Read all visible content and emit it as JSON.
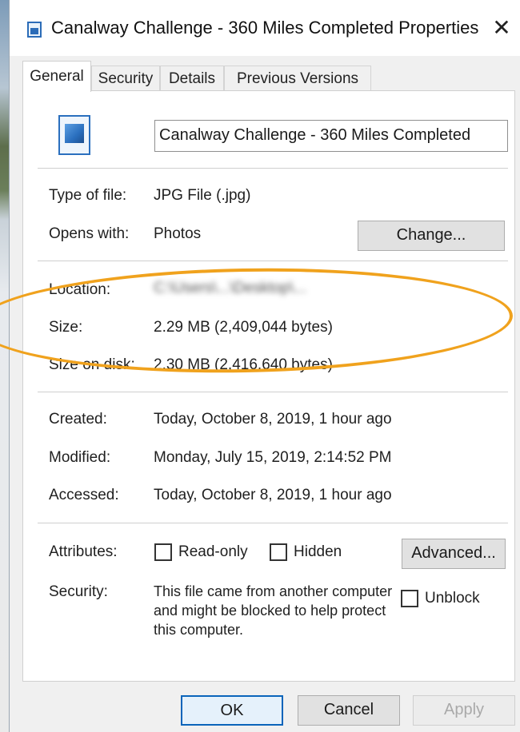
{
  "window": {
    "title": "Canalway Challenge - 360 Miles Completed Properties",
    "close_glyph": "✕"
  },
  "tabs": [
    {
      "label": "General",
      "active": true
    },
    {
      "label": "Security",
      "active": false
    },
    {
      "label": "Details",
      "active": false
    },
    {
      "label": "Previous Versions",
      "active": false
    }
  ],
  "file": {
    "name": "Canalway Challenge - 360 Miles Completed",
    "icon": "image-file-icon"
  },
  "type_info": {
    "type_label": "Type of file:",
    "type_value": "JPG File (.jpg)",
    "opens_label": "Opens with:",
    "opens_value": "Photos",
    "change_button": "Change..."
  },
  "location": {
    "location_label": "Location:",
    "location_value": "C:\\Users\\...\\Desktop\\...",
    "size_label": "Size:",
    "size_value": "2.29 MB (2,409,044 bytes)",
    "size_on_disk_label": "Size on disk:",
    "size_on_disk_value": "2.30 MB (2,416,640 bytes)"
  },
  "dates": {
    "created_label": "Created:",
    "created_value": "Today, October 8, 2019, 1 hour ago",
    "modified_label": "Modified:",
    "modified_value": "Monday, July 15, 2019, 2:14:52 PM",
    "accessed_label": "Accessed:",
    "accessed_value": "Today, October 8, 2019, 1 hour ago"
  },
  "attributes": {
    "label": "Attributes:",
    "readonly_label": "Read-only",
    "hidden_label": "Hidden",
    "advanced_button": "Advanced..."
  },
  "security": {
    "label": "Security:",
    "message": "This file came from another computer and might be blocked to help protect this computer.",
    "unblock_label": "Unblock"
  },
  "footer": {
    "ok": "OK",
    "cancel": "Cancel",
    "apply": "Apply"
  },
  "colors": {
    "highlight": "#f0a21d",
    "accent": "#0a64ba"
  }
}
